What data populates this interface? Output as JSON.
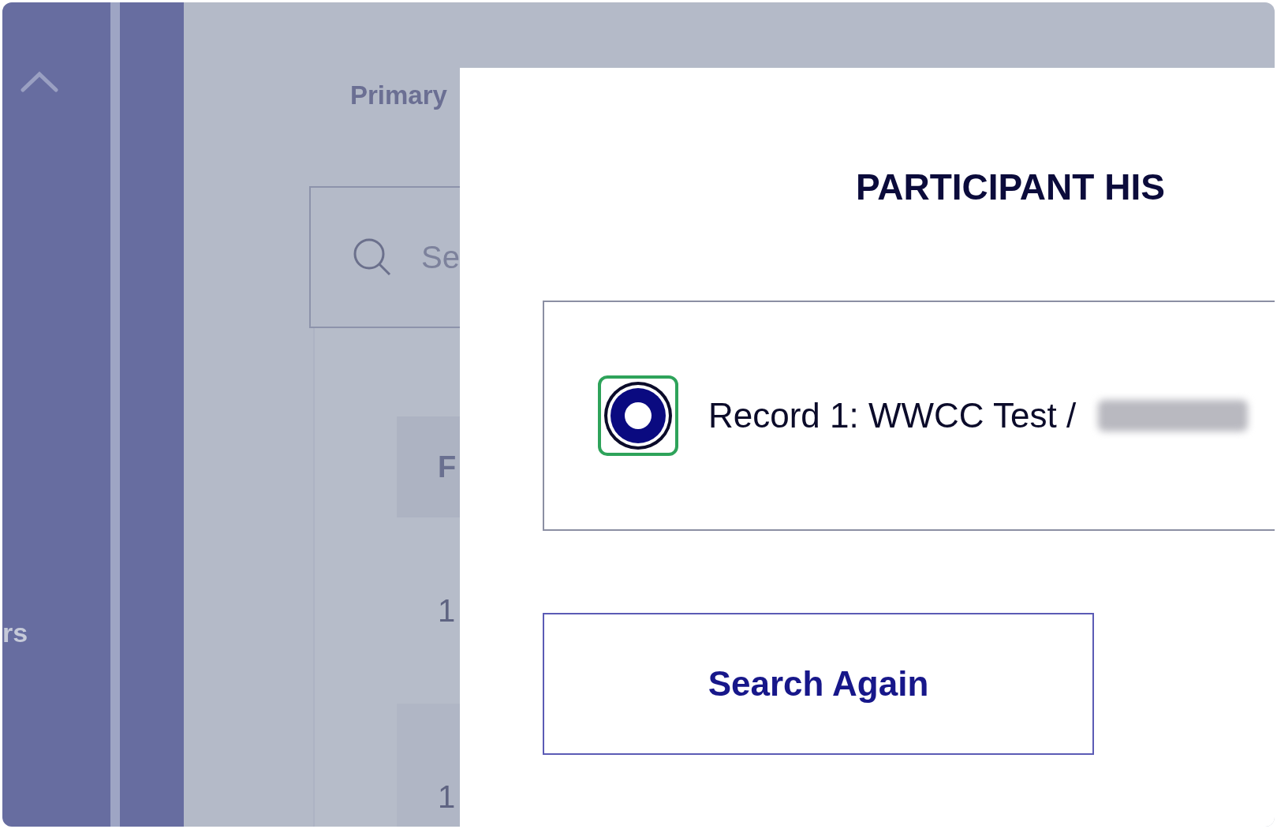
{
  "sidebar": {
    "label": "rs"
  },
  "page": {
    "heading": "Primary",
    "search": {
      "placeholder": "Se"
    },
    "table": {
      "column_1": "F",
      "rows": [
        {
          "cell": "1"
        },
        {
          "cell": "1"
        }
      ]
    }
  },
  "modal": {
    "title": "PARTICIPANT HIS",
    "records": [
      {
        "label": "Record 1: WWCC Test /",
        "selected": true,
        "redacted": true
      }
    ],
    "button": "Search Again"
  }
}
